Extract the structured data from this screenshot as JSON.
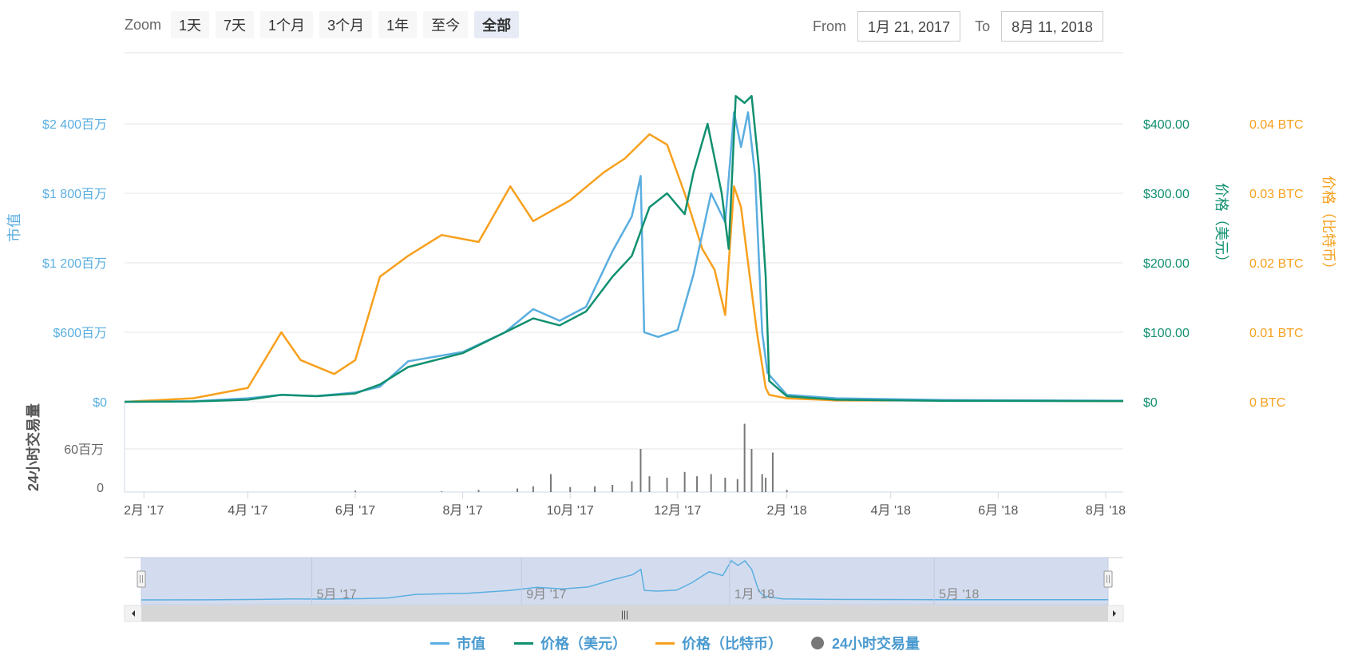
{
  "toolbar": {
    "zoom_label": "Zoom",
    "zoom_buttons": [
      "1天",
      "7天",
      "1个月",
      "3个月",
      "1年",
      "至今",
      "全部"
    ],
    "active_zoom": "全部",
    "from_label": "From",
    "from_value": "1月 21, 2017",
    "to_label": "To",
    "to_value": "8月 11, 2018"
  },
  "colors": {
    "market_cap": "#5aaee0",
    "price_usd": "#119070",
    "price_btc": "#f7a01d",
    "volume": "#777777"
  },
  "chart_data": {
    "type": "line",
    "x_axis": {
      "ticks": [
        "2月 '17",
        "4月 '17",
        "6月 '17",
        "8月 '17",
        "10月 '17",
        "12月 '17",
        "2月 '18",
        "4月 '18",
        "6月 '18",
        "8月 '18"
      ],
      "range": [
        "2017-01-21",
        "2018-08-11"
      ]
    },
    "y_axes": {
      "market_cap": {
        "label": "市值",
        "ticks": [
          "$0",
          "$600百万",
          "$1 200百万",
          "$1 800百万",
          "$2 400百万"
        ],
        "range": [
          0,
          2400
        ]
      },
      "price_usd": {
        "label": "价格（美元）",
        "ticks": [
          "$0",
          "$100.00",
          "$200.00",
          "$300.00",
          "$400.00"
        ],
        "range": [
          0,
          400
        ]
      },
      "price_btc": {
        "label": "价格（比特币）",
        "ticks": [
          "0 BTC",
          "0.01 BTC",
          "0.02 BTC",
          "0.03 BTC",
          "0.04 BTC"
        ],
        "range": [
          0,
          0.04
        ]
      },
      "volume": {
        "label": "24小时交易量",
        "ticks": [
          "0",
          "60百万"
        ],
        "range": [
          0,
          60
        ]
      }
    },
    "series": [
      {
        "name": "市值",
        "axis": "market_cap",
        "x": [
          "2017-01-21",
          "2017-03-01",
          "2017-04-01",
          "2017-04-20",
          "2017-05-10",
          "2017-06-01",
          "2017-06-15",
          "2017-07-01",
          "2017-08-01",
          "2017-08-25",
          "2017-09-10",
          "2017-09-25",
          "2017-10-10",
          "2017-10-25",
          "2017-11-05",
          "2017-11-10",
          "2017-11-12",
          "2017-11-20",
          "2017-12-01",
          "2017-12-10",
          "2017-12-20",
          "2017-12-28",
          "2018-01-02",
          "2018-01-06",
          "2018-01-10",
          "2018-01-14",
          "2018-01-18",
          "2018-01-21",
          "2018-02-01",
          "2018-03-01",
          "2018-05-01",
          "2018-08-11"
        ],
        "values": [
          0,
          5,
          30,
          60,
          50,
          80,
          130,
          350,
          430,
          600,
          800,
          700,
          820,
          1300,
          1600,
          1950,
          600,
          560,
          620,
          1100,
          1800,
          1550,
          2500,
          2200,
          2500,
          1950,
          600,
          250,
          60,
          30,
          15,
          10
        ]
      },
      {
        "name": "价格（美元）",
        "axis": "price_usd",
        "x": [
          "2017-01-21",
          "2017-03-01",
          "2017-04-01",
          "2017-04-20",
          "2017-05-10",
          "2017-06-01",
          "2017-06-15",
          "2017-07-01",
          "2017-08-01",
          "2017-08-25",
          "2017-09-10",
          "2017-09-25",
          "2017-10-10",
          "2017-10-25",
          "2017-11-05",
          "2017-11-15",
          "2017-11-25",
          "2017-12-05",
          "2017-12-10",
          "2017-12-18",
          "2017-12-26",
          "2017-12-30",
          "2018-01-03",
          "2018-01-08",
          "2018-01-12",
          "2018-01-16",
          "2018-01-20",
          "2018-01-22",
          "2018-02-01",
          "2018-03-01",
          "2018-05-01",
          "2018-08-11"
        ],
        "values": [
          0,
          0.5,
          3,
          10,
          8,
          12,
          25,
          50,
          70,
          100,
          120,
          110,
          130,
          180,
          210,
          280,
          300,
          270,
          330,
          400,
          300,
          220,
          440,
          430,
          440,
          340,
          180,
          30,
          8,
          3,
          1.5,
          1
        ]
      },
      {
        "name": "价格（比特币）",
        "axis": "price_btc",
        "x": [
          "2017-01-21",
          "2017-03-01",
          "2017-04-01",
          "2017-04-20",
          "2017-05-01",
          "2017-05-20",
          "2017-06-01",
          "2017-06-15",
          "2017-07-01",
          "2017-07-20",
          "2017-08-10",
          "2017-08-28",
          "2017-09-10",
          "2017-10-01",
          "2017-10-20",
          "2017-11-01",
          "2017-11-15",
          "2017-11-25",
          "2017-12-05",
          "2017-12-15",
          "2017-12-22",
          "2017-12-28",
          "2018-01-02",
          "2018-01-06",
          "2018-01-10",
          "2018-01-15",
          "2018-01-20",
          "2018-01-22",
          "2018-02-01",
          "2018-03-01",
          "2018-05-01",
          "2018-08-11"
        ],
        "values": [
          0,
          0.0005,
          0.002,
          0.01,
          0.006,
          0.004,
          0.006,
          0.018,
          0.021,
          0.024,
          0.023,
          0.031,
          0.026,
          0.029,
          0.033,
          0.035,
          0.0385,
          0.037,
          0.03,
          0.022,
          0.019,
          0.0125,
          0.031,
          0.028,
          0.02,
          0.01,
          0.002,
          0.001,
          0.0005,
          0.0002,
          0.0002,
          0.0001
        ]
      },
      {
        "name": "24小时交易量",
        "axis": "volume",
        "type": "bar",
        "x": [
          "2017-06-01",
          "2017-07-20",
          "2017-08-10",
          "2017-09-01",
          "2017-09-10",
          "2017-09-20",
          "2017-10-01",
          "2017-10-15",
          "2017-10-25",
          "2017-11-05",
          "2017-11-10",
          "2017-11-15",
          "2017-11-25",
          "2017-12-05",
          "2017-12-12",
          "2017-12-20",
          "2017-12-28",
          "2018-01-04",
          "2018-01-08",
          "2018-01-12",
          "2018-01-18",
          "2018-01-20",
          "2018-01-24",
          "2018-02-01"
        ],
        "values": [
          2,
          1,
          3,
          5,
          8,
          25,
          7,
          8,
          10,
          15,
          60,
          22,
          20,
          28,
          22,
          25,
          20,
          18,
          95,
          60,
          25,
          20,
          55,
          3
        ]
      }
    ]
  },
  "navigator": {
    "ticks": [
      "5月 '17",
      "9月 '17",
      "1月 '18",
      "5月 '18"
    ],
    "scroll_icon": "|||"
  },
  "legend": [
    {
      "label": "市值",
      "color": "#5aaee0",
      "type": "line"
    },
    {
      "label": "价格（美元）",
      "color": "#119070",
      "type": "line"
    },
    {
      "label": "价格（比特币）",
      "color": "#f7a01d",
      "type": "line"
    },
    {
      "label": "24小时交易量",
      "color": "#777777",
      "type": "dot"
    }
  ]
}
